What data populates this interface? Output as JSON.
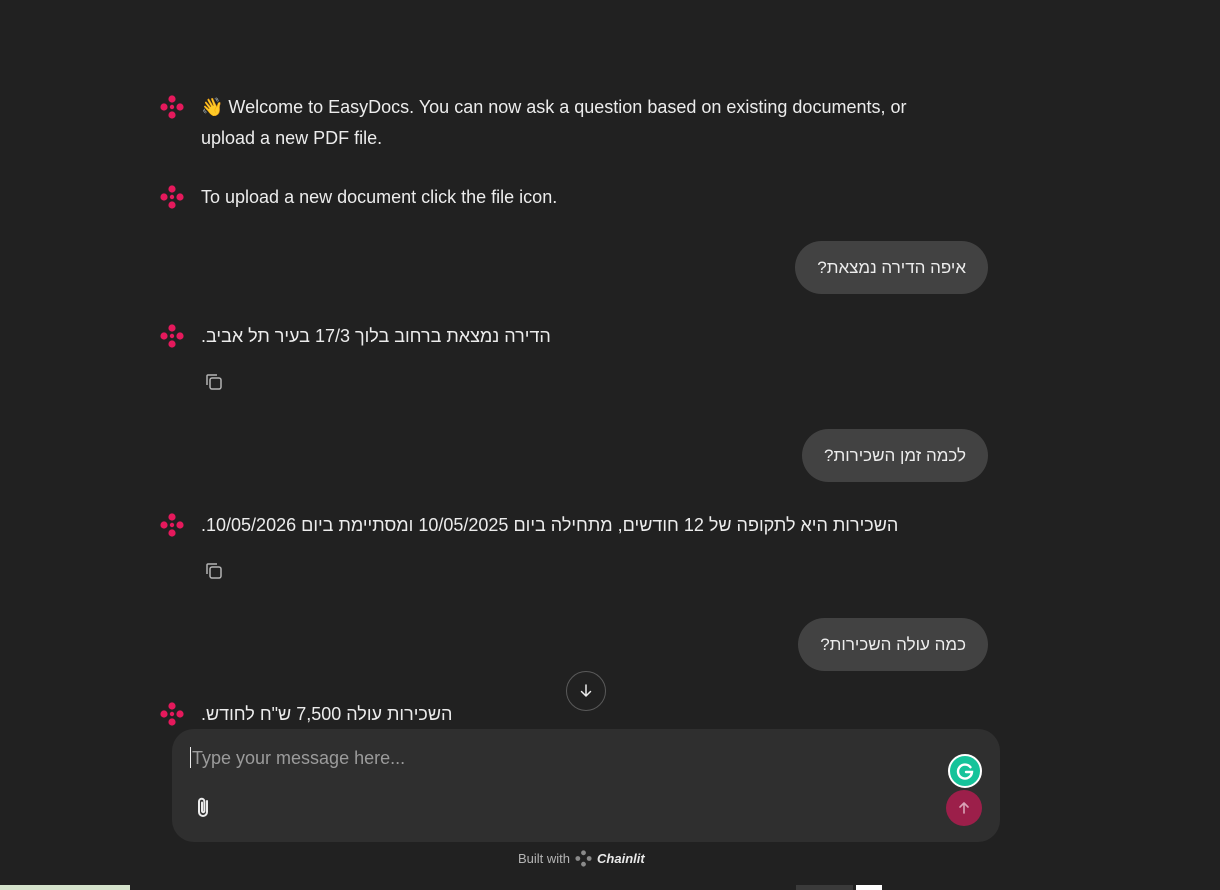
{
  "messages": {
    "bot1": {
      "text": "👋 Welcome to EasyDocs. You can now ask a question based on existing documents, or upload a new PDF file."
    },
    "bot2": {
      "text": "To upload a new document click the file icon."
    },
    "user1": {
      "text": "איפה הדירה נמצאת?"
    },
    "bot3": {
      "text": "הדירה נמצאת ברחוב בלוך 17/3 בעיר תל אביב."
    },
    "user2": {
      "text": "לכמה זמן השכירות?"
    },
    "bot4": {
      "text": "השכירות היא לתקופה של 12 חודשים, מתחילה ביום 10/05/2025 ומסתיימת ביום 10/05/2026."
    },
    "user3": {
      "text": "כמה עולה השכירות?"
    },
    "bot5": {
      "text": "השכירות עולה 7,500 ש\"ח לחודש."
    }
  },
  "composer": {
    "placeholder": "Type your message here...",
    "value": ""
  },
  "footer": {
    "built_with": "Built with",
    "brand": "Chainlit"
  },
  "icons": {
    "avatar": "chainlit-logo-icon",
    "copy": "copy-icon",
    "scroll": "arrow-down-icon",
    "attach": "paperclip-icon",
    "send": "arrow-up-icon",
    "grammarly": "grammarly-icon"
  },
  "colors": {
    "background": "#212121",
    "bubble": "#424242",
    "composer": "#2f2f2f",
    "avatar_accent": "#e5195c",
    "send_button": "#9c1f4a",
    "grammarly": "#15c39a"
  }
}
